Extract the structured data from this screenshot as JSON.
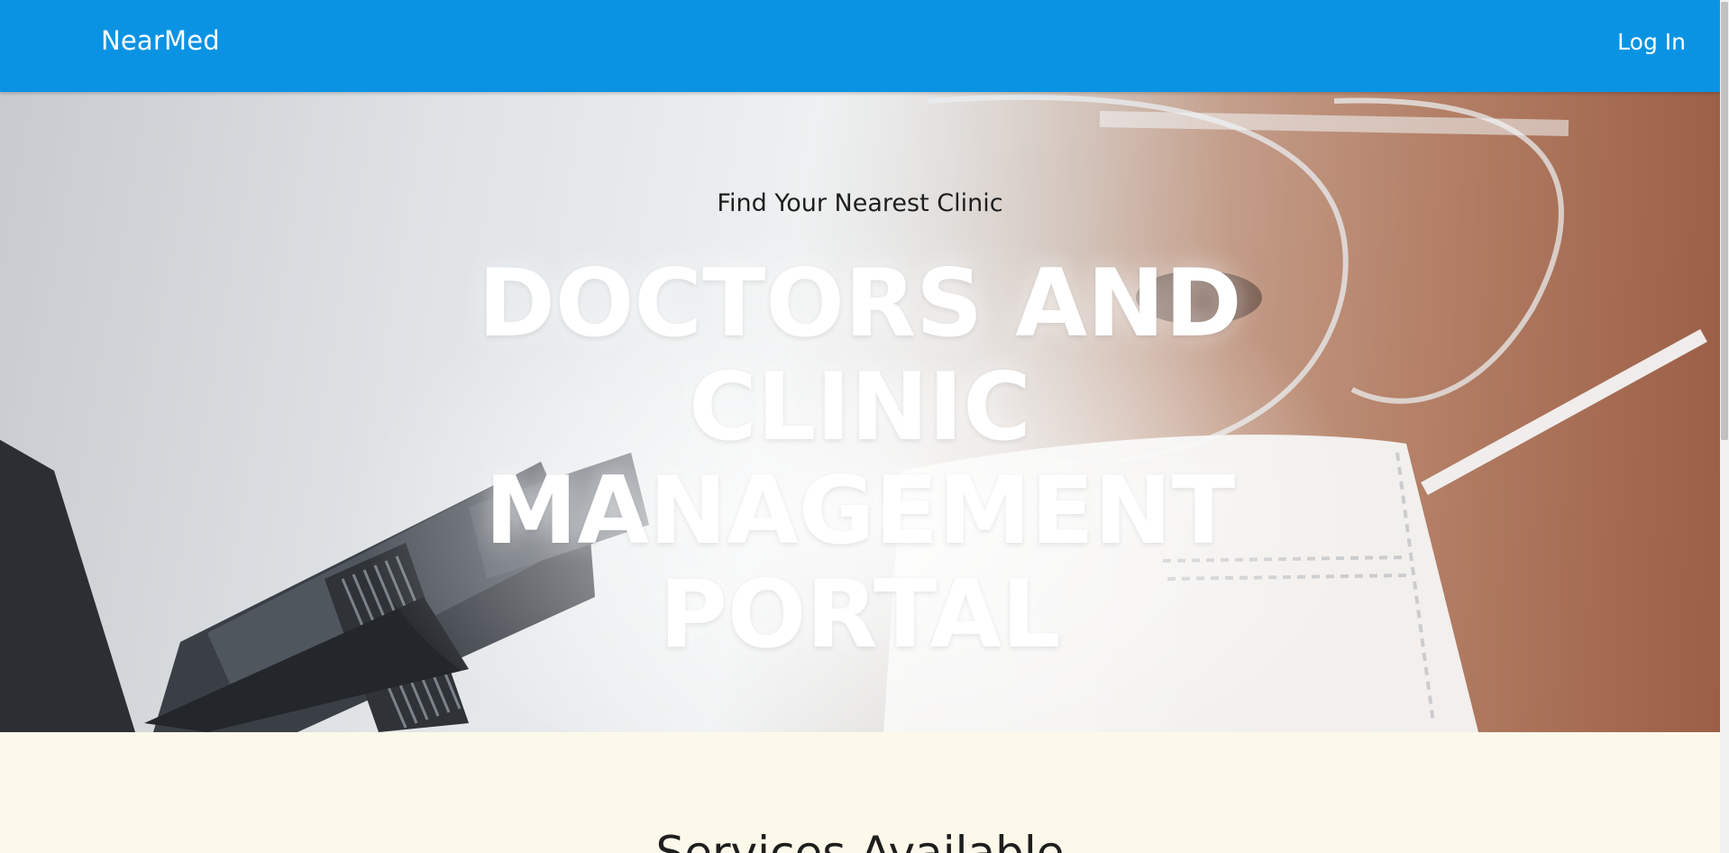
{
  "navbar": {
    "brand": "NearMed",
    "login_label": "Log In"
  },
  "hero": {
    "subtitle": "Find Your Nearest Clinic",
    "title": "DOCTORS AND CLINIC MANAGEMENT PORTAL"
  },
  "services": {
    "heading": "Services Available"
  },
  "colors": {
    "navbar": "#0b93e3",
    "page_background": "#fcf9eb",
    "hero_title": "#ffffff",
    "text_dark": "#1e1e1e"
  }
}
